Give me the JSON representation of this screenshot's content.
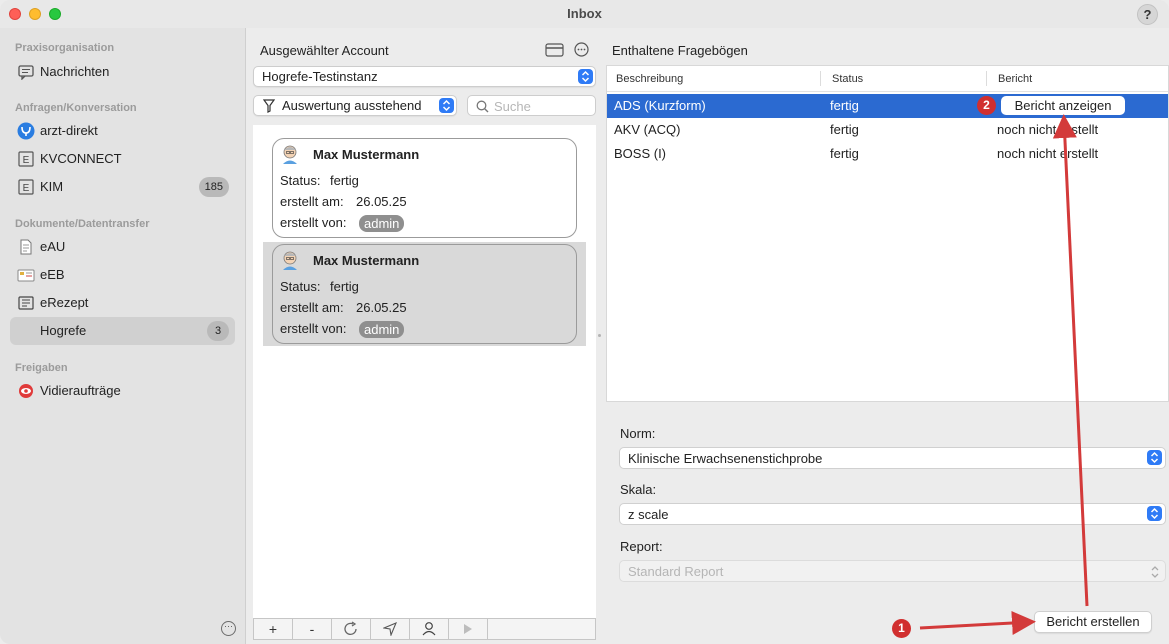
{
  "window": {
    "title": "Inbox",
    "help_label": "?"
  },
  "sidebar": {
    "sections": [
      {
        "label": "Praxisorganisation"
      },
      {
        "label": "Anfragen/Konversation"
      },
      {
        "label": "Dokumente/Datentransfer"
      },
      {
        "label": "Freigaben"
      }
    ],
    "items": [
      {
        "label": "Nachrichten",
        "icon": "speech-bubble-icon"
      },
      {
        "label": "arzt-direkt",
        "icon": "arzt-direkt-icon"
      },
      {
        "label": "KVCONNECT",
        "icon": "letter-e-icon"
      },
      {
        "label": "KIM",
        "icon": "letter-e-icon",
        "badge": "185"
      },
      {
        "label": "eAU",
        "icon": "document-icon"
      },
      {
        "label": "eEB",
        "icon": "card-icon"
      },
      {
        "label": "eRezept",
        "icon": "prescription-icon"
      },
      {
        "label": "Hogrefe",
        "badge": "3",
        "selected": true
      },
      {
        "label": "Vidieraufträge",
        "icon": "eye-icon"
      }
    ]
  },
  "middle": {
    "title": "Ausgewählter Account",
    "account_select": "Hogrefe-Testinstanz",
    "filter_select": "Auswertung ausstehend",
    "search_placeholder": "Suche",
    "cards": [
      {
        "name": "Max Mustermann",
        "status_label": "Status:",
        "status": "fertig",
        "created_label": "erstellt am:",
        "created": "26.05.25",
        "by_label": "erstellt von:",
        "by": "admin"
      },
      {
        "name": "Max Mustermann",
        "status_label": "Status:",
        "status": "fertig",
        "created_label": "erstellt am:",
        "created": "26.05.25",
        "by_label": "erstellt von:",
        "by": "admin",
        "selected": true
      }
    ],
    "bottom_buttons": [
      "+",
      "-",
      "↻",
      "send",
      "person",
      "▶"
    ]
  },
  "right": {
    "title": "Enthaltene Fragebögen",
    "columns": [
      "Beschreibung",
      "Status",
      "Bericht"
    ],
    "rows": [
      {
        "desc": "ADS (Kurzform)",
        "status": "fertig",
        "report": "Bericht anzeigen",
        "selected": true
      },
      {
        "desc": "AKV (ACQ)",
        "status": "fertig",
        "report": "noch nicht erstellt"
      },
      {
        "desc": "BOSS (I)",
        "status": "fertig",
        "report": "noch nicht erstellt"
      }
    ],
    "norm_label": "Norm:",
    "norm_value": "Klinische Erwachsenenstichprobe",
    "scale_label": "Skala:",
    "scale_value": "z scale",
    "report_label": "Report:",
    "report_value": "Standard Report",
    "create_button": "Bericht erstellen"
  },
  "annotations": {
    "badge1": "1",
    "badge2": "2",
    "color": "#d12f2f"
  }
}
